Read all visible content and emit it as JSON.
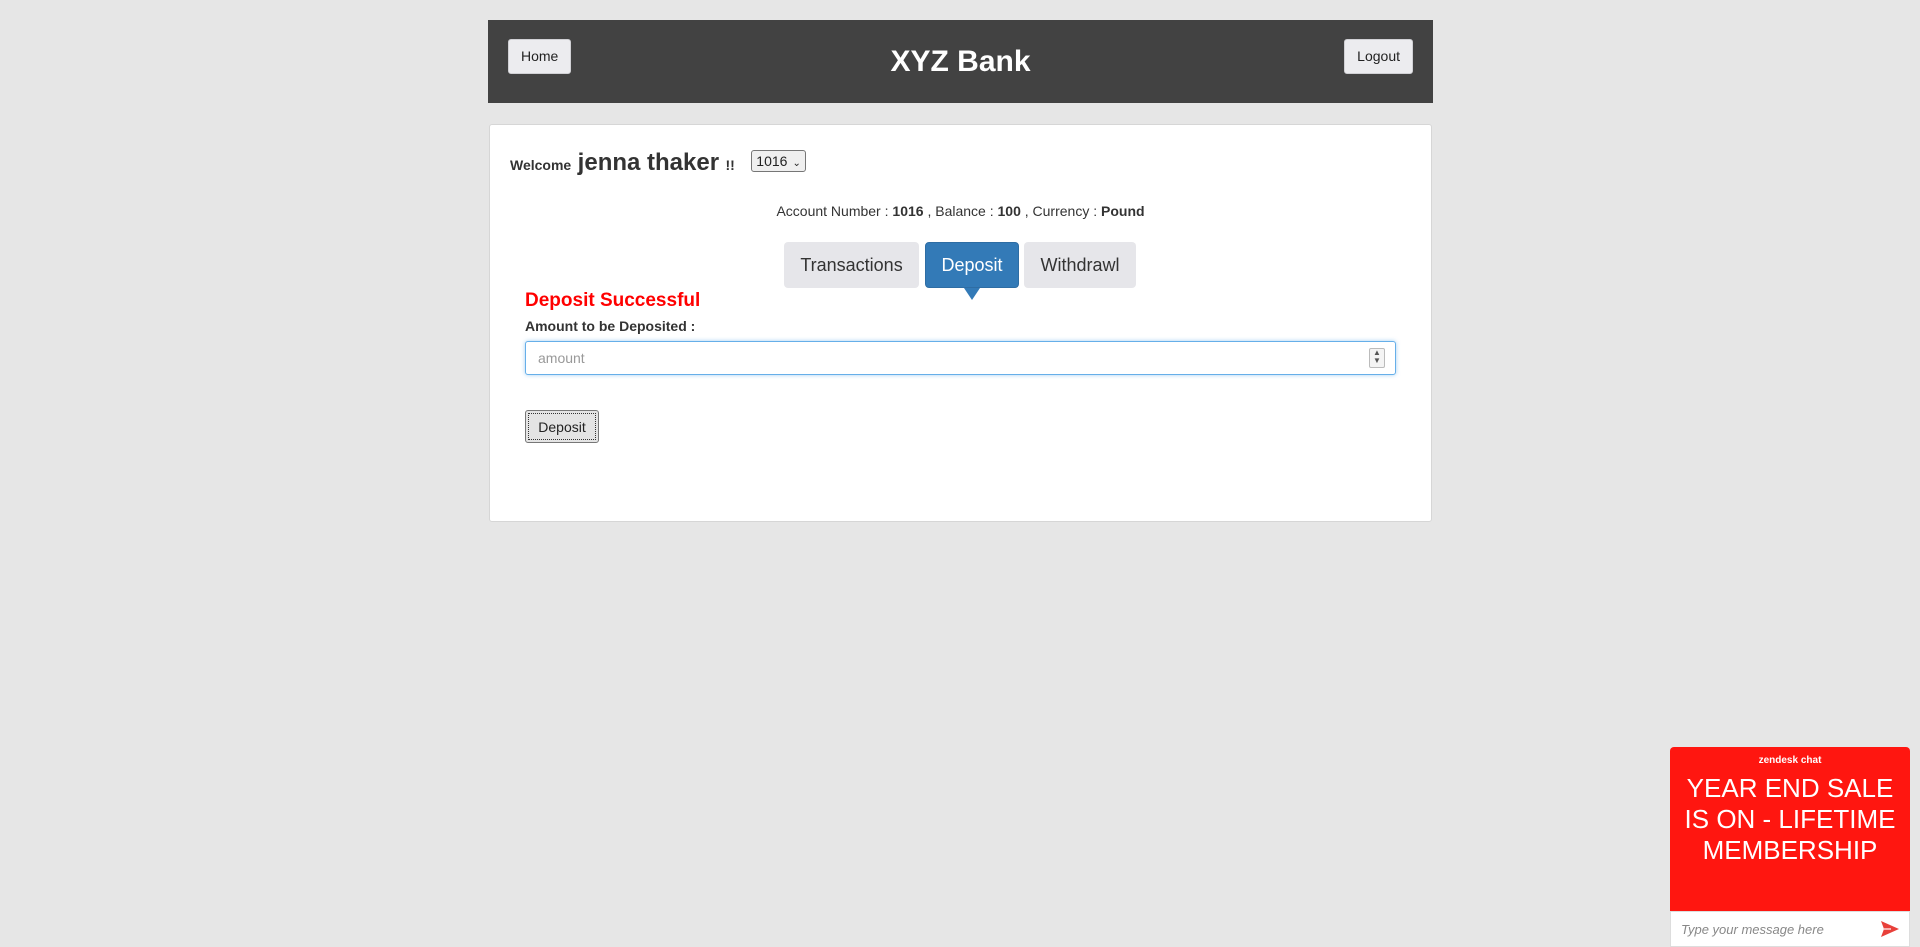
{
  "header": {
    "title": "XYZ Bank",
    "home_label": "Home",
    "logout_label": "Logout"
  },
  "welcome": {
    "prefix": "Welcome",
    "customer_name": "jenna thaker",
    "suffix": "!!",
    "account_selected": "1016"
  },
  "account_info": {
    "number_label": "Account Number :",
    "number": "1016",
    "balance_label": ", Balance :",
    "balance": "100",
    "currency_label": ", Currency :",
    "currency": "Pound"
  },
  "tabs": [
    {
      "label": "Transactions",
      "active": false
    },
    {
      "label": "Deposit",
      "active": true
    },
    {
      "label": "Withdrawl",
      "active": false
    }
  ],
  "deposit_form": {
    "success_message": "Deposit Successful",
    "amount_label": "Amount to be Deposited :",
    "amount_placeholder": "amount",
    "amount_value": "",
    "submit_label": "Deposit"
  },
  "chat_widget": {
    "brand": "zendesk chat",
    "promo": "YEAR END SALE IS ON - LIFETIME MEMBERSHIP",
    "input_placeholder": "Type your message here",
    "send_icon": "send-arrow-icon",
    "accent_color": "#ff1610"
  },
  "colors": {
    "header_bg": "#424242",
    "active_tab": "#337ab7",
    "success_text": "#ff0000",
    "page_bg": "#e6e6e6"
  }
}
